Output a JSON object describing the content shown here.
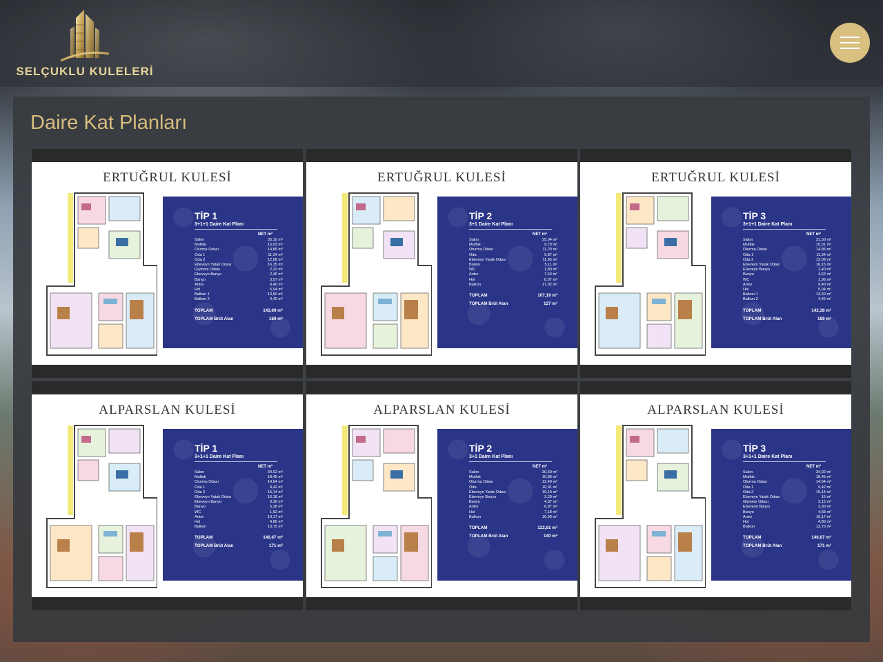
{
  "header": {
    "logo_text": "SELÇUKLU KULELERİ",
    "logo_icon": "tower-logo-icon",
    "menu_icon": "hamburger-icon"
  },
  "colors": {
    "accent_gold": "#d9bf80",
    "title_gold": "#d8bd7c",
    "spec_blue": "#2a3588"
  },
  "section": {
    "title": "Daire Kat Planları"
  },
  "plans": [
    {
      "tower": "ERTUĞRUL KULESİ",
      "type": "TİP 1",
      "subtitle": "3+1+1 Daire Kat Planı",
      "net_label": "NET m²",
      "rows": [
        {
          "room": "Salon",
          "area": "35,10 m²"
        },
        {
          "room": "Mutfak",
          "area": "15,03 m²"
        },
        {
          "room": "Oturma Odası",
          "area": "14,86 m²"
        },
        {
          "room": "Oda 1",
          "area": "11,34 m²"
        },
        {
          "room": "Oda 2",
          "area": "12,08 m²"
        },
        {
          "room": "Ebeveyn Yatak Odası",
          "area": "16,15 m²"
        },
        {
          "room": "Giyinme Odası",
          "area": "2,32 m²"
        },
        {
          "room": "Ebeveyn Banyo",
          "area": "2,40 m²"
        },
        {
          "room": "Banyo",
          "area": "3,57 m²"
        },
        {
          "room": "Antre",
          "area": "9,40 m²"
        },
        {
          "room": "Hol",
          "area": "5,04 m²"
        },
        {
          "room": "Balkon 1",
          "area": "13,60 m²"
        },
        {
          "room": "Balkon 2",
          "area": "4,42 m²"
        }
      ],
      "total_label": "TOPLAM",
      "total": "143,69 m²",
      "gross_label": "TOPLAM Brüt Alan",
      "gross": "169 m²"
    },
    {
      "tower": "ERTUĞRUL KULESİ",
      "type": "TİP 2",
      "subtitle": "3+1 Daire Kat Planı",
      "net_label": "NET m²",
      "rows": [
        {
          "room": "Salon",
          "area": "25,04 m²"
        },
        {
          "room": "Mutfak",
          "area": "9,70 m²"
        },
        {
          "room": "Oturma Odası",
          "area": "11,20 m²"
        },
        {
          "room": "Oda",
          "area": "9,87 m²"
        },
        {
          "room": "Ebeveyn Yatak Odası",
          "area": "11,85 m²"
        },
        {
          "room": "Banyo",
          "area": "5,11 m²"
        },
        {
          "room": "WC",
          "area": "1,80 m²"
        },
        {
          "room": "Antre",
          "area": "7,53 m²"
        },
        {
          "room": "Hol",
          "area": "8,07 m²"
        },
        {
          "room": "Balkon",
          "area": "17,02 m²"
        }
      ],
      "total_label": "TOPLAM",
      "total": "107,19 m²",
      "gross_label": "TOPLAM Brüt Alan",
      "gross": "127 m²"
    },
    {
      "tower": "ERTUĞRUL KULESİ",
      "type": "TİP 3",
      "subtitle": "3+1+1 Daire Kat Planı",
      "net_label": "NET m²",
      "rows": [
        {
          "room": "Salon",
          "area": "31,50 m²"
        },
        {
          "room": "Mutfak",
          "area": "15,01 m²"
        },
        {
          "room": "Oturma Odası",
          "area": "14,86 m²"
        },
        {
          "room": "Oda 1",
          "area": "11,34 m²"
        },
        {
          "room": "Oda 2",
          "area": "12,08 m²"
        },
        {
          "room": "Ebeveyn Yatak Odası",
          "area": "16,15 m²"
        },
        {
          "room": "Ebeveyn Banyo",
          "area": "2,40 m²"
        },
        {
          "room": "Banyo",
          "area": "4,62 m²"
        },
        {
          "room": "WC",
          "area": "1,96 m²"
        },
        {
          "room": "Antre",
          "area": "9,40 m²"
        },
        {
          "room": "Hol",
          "area": "5,04 m²"
        },
        {
          "room": "Balkon 1",
          "area": "13,60 m²"
        },
        {
          "room": "Balkon 2",
          "area": "4,42 m²"
        }
      ],
      "total_label": "TOPLAM",
      "total": "142,38 m²",
      "gross_label": "TOPLAM Brüt Alan",
      "gross": "169 m²"
    },
    {
      "tower": "ALPARSLAN KULESİ",
      "type": "TİP 1",
      "subtitle": "3+1+1 Daire Kat Planı",
      "net_label": "NET m²",
      "rows": [
        {
          "room": "Salon",
          "area": "34,02 m²"
        },
        {
          "room": "Mutfak",
          "area": "18,45 m²"
        },
        {
          "room": "Oturma Odası",
          "area": "14,64 m²"
        },
        {
          "room": "Oda 1",
          "area": "9,42 m²"
        },
        {
          "room": "Oda 2",
          "area": "15,14 m²"
        },
        {
          "room": "Ebeveyn Yatak Odası",
          "area": "16,18 m²"
        },
        {
          "room": "Ebeveyn Banyo",
          "area": "3,30 m²"
        },
        {
          "room": "Banyo",
          "area": "5,28 m²"
        },
        {
          "room": "WC",
          "area": "1,52 m²"
        },
        {
          "room": "Antre",
          "area": "10,17 m²"
        },
        {
          "room": "Hol",
          "area": "4,80 m²"
        },
        {
          "room": "Balkon",
          "area": "13,75 m²"
        }
      ],
      "total_label": "TOPLAM",
      "total": "146,67 m²",
      "gross_label": "TOPLAM Brüt Alan",
      "gross": "171 m²"
    },
    {
      "tower": "ALPARSLAN KULESİ",
      "type": "TİP 2",
      "subtitle": "3+1 Daire Kat Planı",
      "net_label": "NET m²",
      "rows": [
        {
          "room": "Salon",
          "area": "30,60 m²"
        },
        {
          "room": "Mutfak",
          "area": "10,86 m²"
        },
        {
          "room": "Oturma Odası",
          "area": "12,40 m²"
        },
        {
          "room": "Oda",
          "area": "10,91 m²"
        },
        {
          "room": "Ebeveyn Yatak Odası",
          "area": "19,10 m²"
        },
        {
          "room": "Ebeveyn Banyo",
          "area": "3,29 m²"
        },
        {
          "room": "Banyo",
          "area": "4,37 m²"
        },
        {
          "room": "Antre",
          "area": "6,97 m²"
        },
        {
          "room": "Hol",
          "area": "7,18 m²"
        },
        {
          "room": "Balkon",
          "area": "16,93 m²"
        }
      ],
      "total_label": "TOPLAM",
      "total": "122,61 m²",
      "gross_label": "TOPLAM Brüt Alan",
      "gross": "140 m²"
    },
    {
      "tower": "ALPARSLAN KULESİ",
      "type": "TİP 3",
      "subtitle": "3+1+1 Daire Kat Planı",
      "net_label": "NET m²",
      "rows": [
        {
          "room": "Salon",
          "area": "34,02 m²"
        },
        {
          "room": "Mutfak",
          "area": "18,45 m²"
        },
        {
          "room": "Oturma Odası",
          "area": "14,64 m²"
        },
        {
          "room": "Oda 1",
          "area": "9,42 m²"
        },
        {
          "room": "Oda 2",
          "area": "15,14 m²"
        },
        {
          "room": "Ebeveyn Yatak Odası",
          "area": "15 m²"
        },
        {
          "room": "Giyinme Odası",
          "area": "3,15 m²"
        },
        {
          "room": "Ebeveyn Banyo",
          "area": "3,30 m²"
        },
        {
          "room": "Banyo",
          "area": "4,83 m²"
        },
        {
          "room": "Antre",
          "area": "10,17 m²"
        },
        {
          "room": "Hol",
          "area": "4,80 m²"
        },
        {
          "room": "Balkon",
          "area": "13,75 m²"
        }
      ],
      "total_label": "TOPLAM",
      "total": "146,67 m²",
      "gross_label": "TOPLAM Brüt Alan",
      "gross": "171 m²"
    }
  ]
}
